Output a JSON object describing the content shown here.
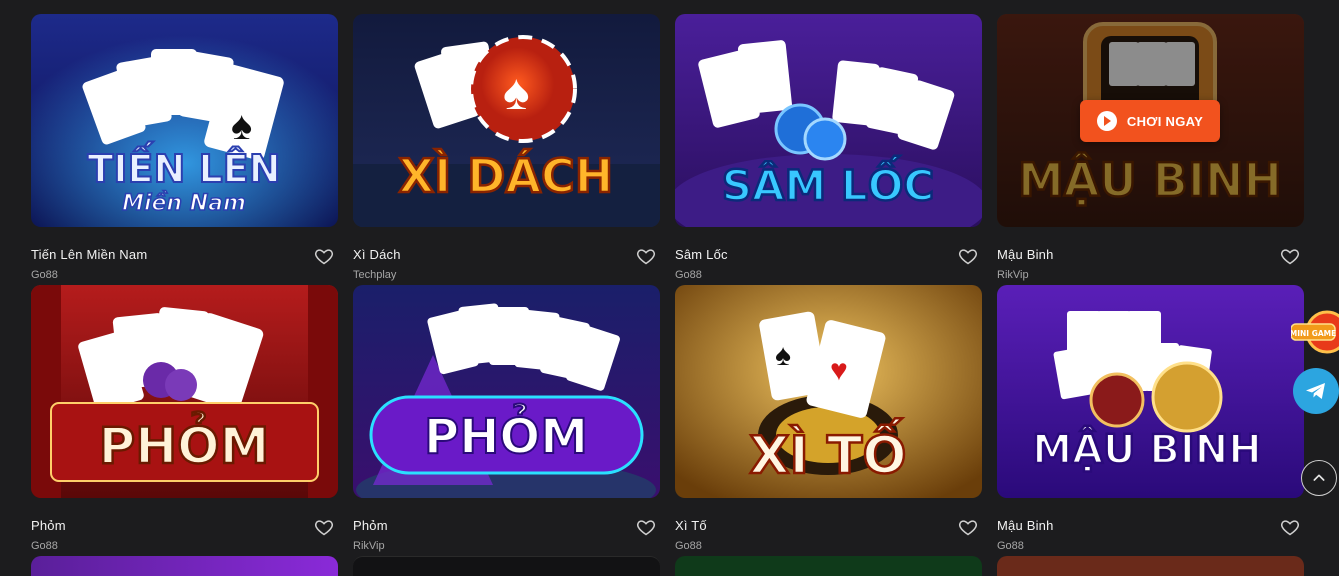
{
  "play_now_label": "CHƠI NGAY",
  "games": [
    {
      "title": "Tiến Lên Miền Nam",
      "provider": "Go88",
      "art_line1": "TIẾN LÊN",
      "art_line2": "Miền Nam",
      "palette": "blue"
    },
    {
      "title": "Xì Dách",
      "provider": "Techplay",
      "art_line1": "XÌ DÁCH",
      "art_line2": "",
      "palette": "night"
    },
    {
      "title": "Sâm Lốc",
      "provider": "Go88",
      "art_line1": "SÂM LỐC",
      "art_line2": "",
      "palette": "purple"
    },
    {
      "title": "Mậu Binh",
      "provider": "RikVip",
      "art_line1": "MẬU BINH",
      "art_line2": "",
      "palette": "brown",
      "hovered": true
    },
    {
      "title": "Phỏm",
      "provider": "Go88",
      "art_line1": "PHỎM",
      "art_line2": "",
      "palette": "red"
    },
    {
      "title": "Phỏm",
      "provider": "RikVip",
      "art_line1": "PHỎM",
      "art_line2": "",
      "palette": "neon"
    },
    {
      "title": "Xì Tố",
      "provider": "Go88",
      "art_line1": "XÌ TỐ",
      "art_line2": "",
      "palette": "gold"
    },
    {
      "title": "Mậu Binh",
      "provider": "Go88",
      "art_line1": "MẬU BINH",
      "art_line2": "",
      "palette": "violet"
    }
  ],
  "floating": {
    "mini_game_label": "MINI GAME",
    "telegram_icon": "telegram-icon",
    "scroll_top_icon": "chevron-up-icon"
  },
  "colors": {
    "background": "#1c1c1e",
    "accent": "#f2521e",
    "telegram": "#2ca5e0"
  }
}
